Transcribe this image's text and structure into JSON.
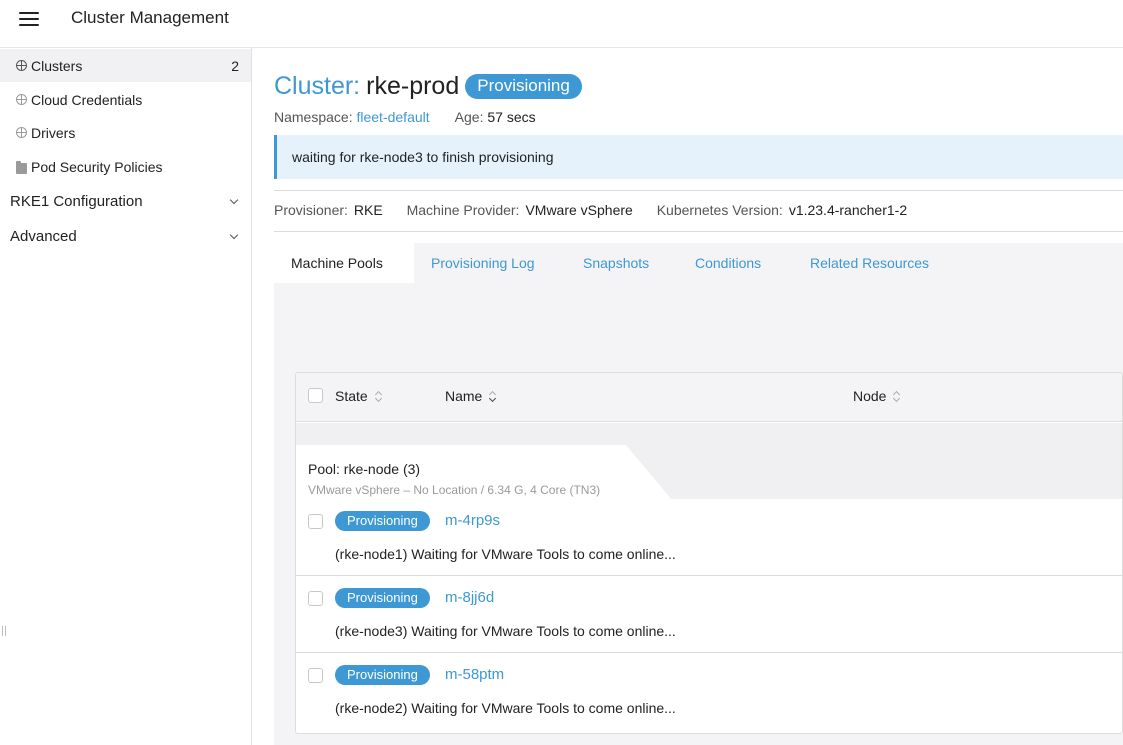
{
  "header": {
    "title": "Cluster Management"
  },
  "sidebar": {
    "items": [
      {
        "label": "Clusters",
        "count": "2"
      },
      {
        "label": "Cloud Credentials"
      },
      {
        "label": "Drivers"
      },
      {
        "label": "Pod Security Policies"
      }
    ],
    "groups": [
      {
        "label": "RKE1 Configuration"
      },
      {
        "label": "Advanced"
      }
    ]
  },
  "cluster": {
    "prefix": "Cluster:",
    "name": "rke-prod",
    "state": "Provisioning",
    "namespace_label": "Namespace:",
    "namespace": "fleet-default",
    "age_label": "Age:",
    "age": "57 secs",
    "banner": "waiting for rke-node3 to finish provisioning",
    "provisioner_label": "Provisioner:",
    "provisioner": "RKE",
    "machine_provider_label": "Machine Provider:",
    "machine_provider": "VMware vSphere",
    "k8s_version_label": "Kubernetes Version:",
    "k8s_version": "v1.23.4-rancher1-2"
  },
  "tabs": [
    {
      "label": "Machine Pools"
    },
    {
      "label": "Provisioning Log"
    },
    {
      "label": "Snapshots"
    },
    {
      "label": "Conditions"
    },
    {
      "label": "Related Resources"
    }
  ],
  "table": {
    "columns": [
      {
        "label": "State"
      },
      {
        "label": "Name"
      },
      {
        "label": "Node"
      }
    ],
    "pool": {
      "title": "Pool: rke-node (3)",
      "subtitle": "VMware vSphere – No Location / 6.34 G, 4 Core (TN3)"
    },
    "rows": [
      {
        "state": "Provisioning",
        "name": "m-4rp9s",
        "message": "(rke-node1) Waiting for VMware Tools to come online..."
      },
      {
        "state": "Provisioning",
        "name": "m-8jj6d",
        "message": "(rke-node3) Waiting for VMware Tools to come online..."
      },
      {
        "state": "Provisioning",
        "name": "m-58ptm",
        "message": "(rke-node2) Waiting for VMware Tools to come online..."
      }
    ]
  },
  "colors": {
    "accent": "#3d98d3",
    "banner_bg": "#e5f2fb",
    "panel_bg": "#f4f4f6"
  },
  "icons": [
    "menu-icon",
    "globe-icon",
    "folder-icon",
    "chevron-down-icon",
    "sort-icon"
  ]
}
